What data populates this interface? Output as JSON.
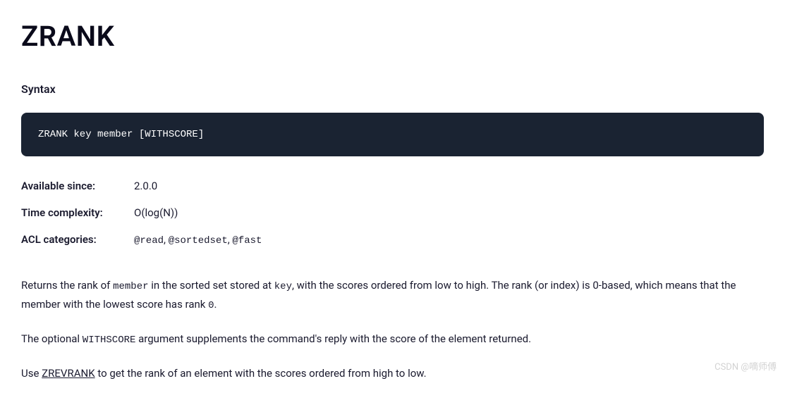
{
  "title": "ZRANK",
  "syntax": {
    "heading": "Syntax",
    "code": "ZRANK key member [WITHSCORE]"
  },
  "meta": {
    "available_since": {
      "label": "Available since:",
      "value": "2.0.0"
    },
    "time_complexity": {
      "label": "Time complexity:",
      "value": "O(log(N))"
    },
    "acl_categories": {
      "label": "ACL categories:",
      "values": [
        "@read",
        "@sortedset",
        "@fast"
      ]
    }
  },
  "description": {
    "p1": {
      "pre_member": "Returns the rank of ",
      "member": "member",
      "mid1": " in the sorted set stored at ",
      "key": "key",
      "mid2": ", with the scores ordered from low to high. The rank (or index) is 0-based, which means that the member with the lowest score has rank ",
      "rank": "0",
      "post": "."
    },
    "p2": {
      "pre": "The optional ",
      "withscore": "WITHSCORE",
      "post": " argument supplements the command's reply with the score of the element returned."
    },
    "p3": {
      "pre": "Use ",
      "link": "ZREVRANK",
      "post": " to get the rank of an element with the scores ordered from high to low."
    }
  },
  "watermark": "CSDN @嘀师傅"
}
